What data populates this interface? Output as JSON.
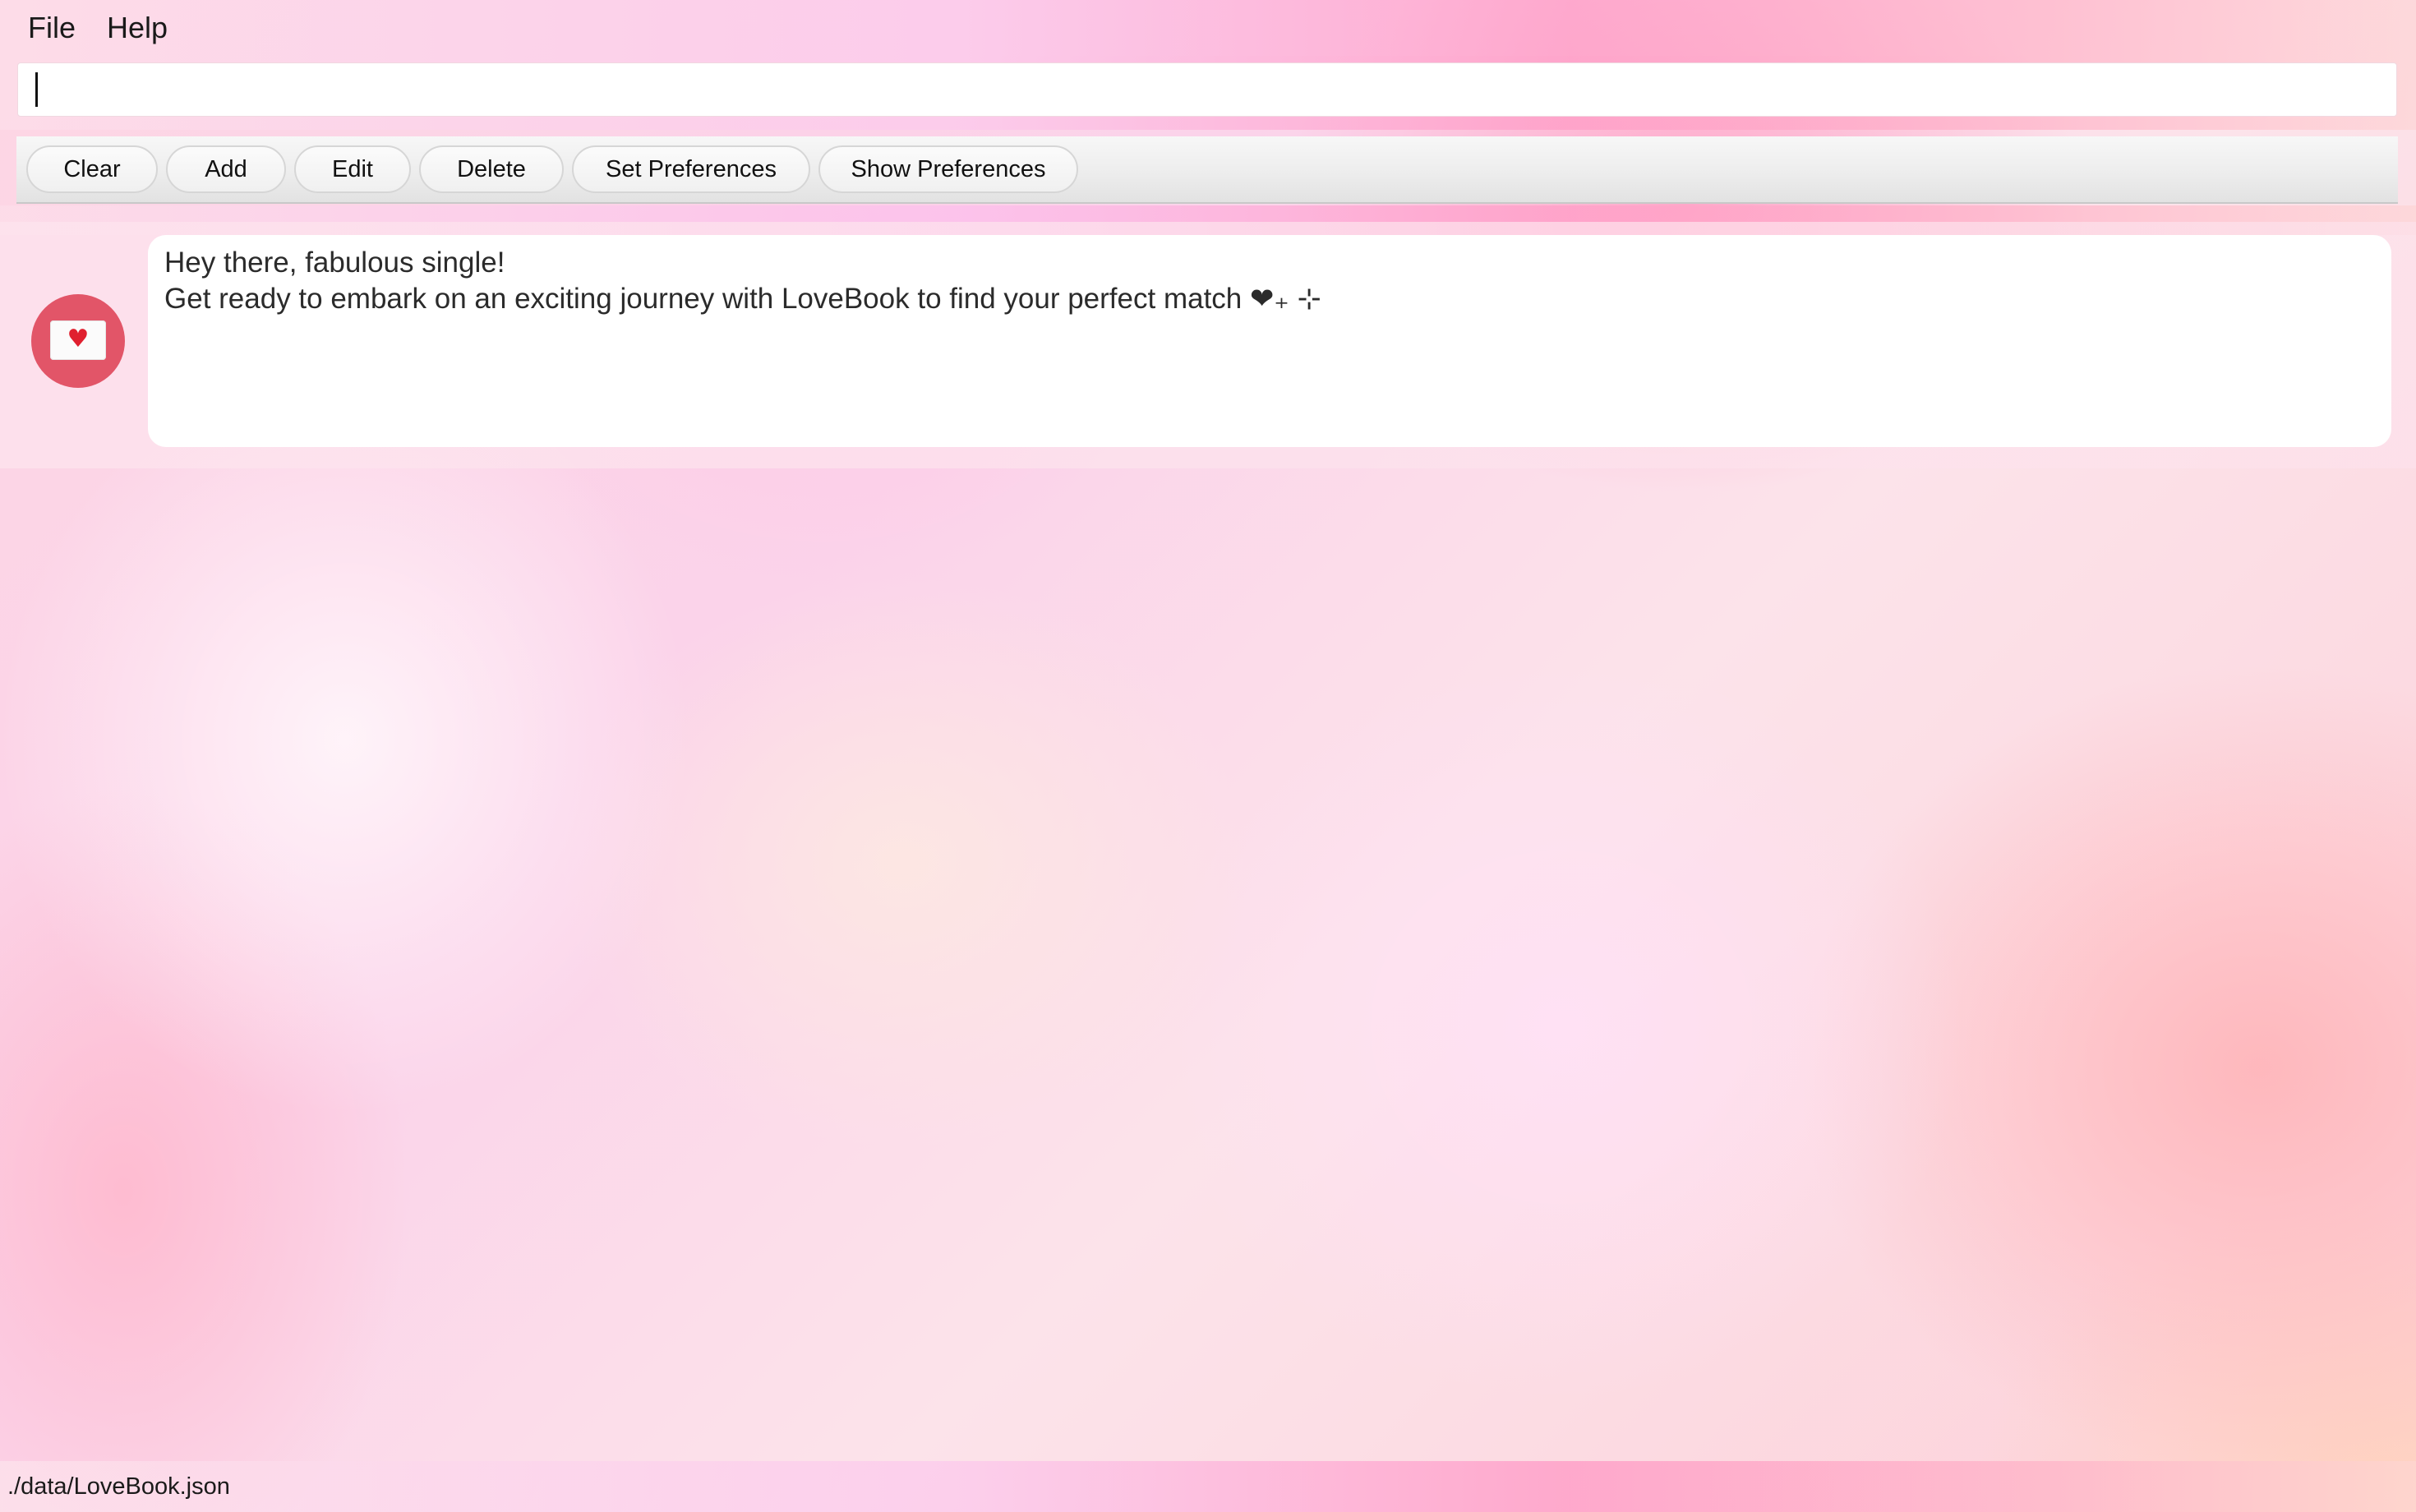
{
  "menu": {
    "items": [
      {
        "label": "File"
      },
      {
        "label": "Help"
      }
    ]
  },
  "command_box": {
    "value": "",
    "placeholder": ""
  },
  "toolbar": {
    "buttons": [
      {
        "label": "Clear"
      },
      {
        "label": "Add"
      },
      {
        "label": "Edit"
      },
      {
        "label": "Delete"
      },
      {
        "label": "Set Preferences"
      },
      {
        "label": "Show Preferences"
      }
    ]
  },
  "result": {
    "avatar_icon": "envelope-heart-icon",
    "lines": [
      "Hey there, fabulous single!",
      "Get ready to embark on an exciting journey with LoveBook to find your perfect match ❤︎₊ ⊹"
    ]
  },
  "status_bar": {
    "file_path": "./data/LoveBook.json"
  },
  "colors": {
    "avatar_background": "#e25568",
    "heart": "#e0202f"
  }
}
